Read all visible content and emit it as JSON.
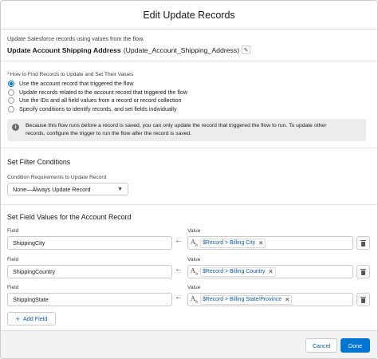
{
  "modal": {
    "title": "Edit Update Records"
  },
  "intro": "Update Salesforce records using values from the flow.",
  "element": {
    "label": "Update Account Shipping Address",
    "api_name": "(Update_Account_Shipping_Address)"
  },
  "how_to_find": {
    "required_mark": "*",
    "label": "How to Find Records to Update and Set Their Values",
    "options": [
      {
        "label": "Use the account record that triggered the flow",
        "selected": true
      },
      {
        "label": "Update records related to the account record that triggered the flow",
        "selected": false
      },
      {
        "label": "Use the IDs and all field values from a record or record collection",
        "selected": false
      },
      {
        "label": "Specify conditions to identify records, and set fields individually",
        "selected": false
      }
    ]
  },
  "info": {
    "line1_a": "Because this flow runs ",
    "line1_em": "before",
    "line1_b": " a record is saved, you can only update the record that triggered the flow to run. To update other",
    "line2_a": "records, configure the trigger to run the flow ",
    "line2_em": "after",
    "line2_b": " the record is saved."
  },
  "filter": {
    "title": "Set Filter Conditions",
    "condition_label": "Condition Requirements to Update Record",
    "condition_value": "None—Always Update Record"
  },
  "field_values": {
    "title": "Set Field Values for the Account Record",
    "field_label": "Field",
    "value_label": "Value",
    "rows": [
      {
        "field": "ShippingCity",
        "value": "$Record > Billing City"
      },
      {
        "field": "ShippingCountry",
        "value": "$Record > Billing Country"
      },
      {
        "field": "ShippingState",
        "value": "$Record > Billing State/Province"
      }
    ],
    "add_label": "Add Field"
  },
  "footer": {
    "cancel_label": "Cancel",
    "done_label": "Done"
  },
  "colors": {
    "brand": "#0176d3",
    "link": "#0b5cab"
  },
  "icons": {
    "edit": "pencil-icon",
    "info": "info-icon",
    "arrow": "left-arrow-icon",
    "resource": "text-resource-icon",
    "remove": "close-icon",
    "delete": "trash-icon",
    "add": "plus-icon"
  }
}
